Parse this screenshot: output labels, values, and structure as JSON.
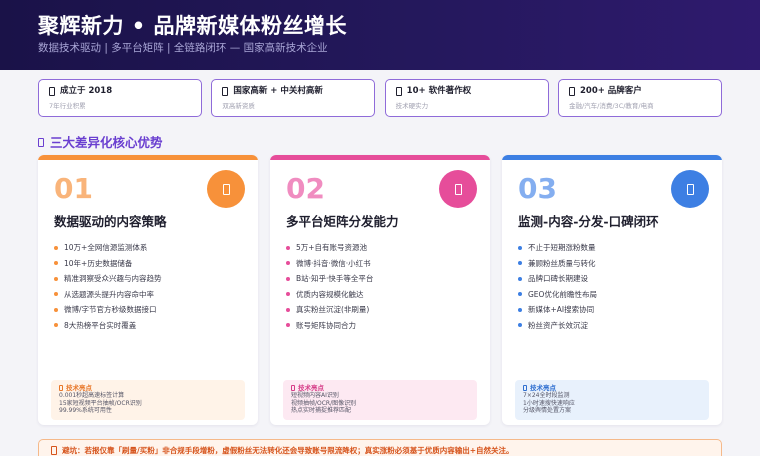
{
  "header": {
    "title": "聚辉新力 • 品牌新媒体粉丝增长",
    "subtitle": "数据技术驱动 | 多平台矩阵 | 全链路闭环 — 国家高新技术企业"
  },
  "badges": [
    {
      "title": "成立于 2018",
      "sub": "7年行业积累",
      "icon": "calendar-icon"
    },
    {
      "title": "国家高新 + 中关村高新",
      "sub": "双高新资质",
      "icon": "certificate-icon"
    },
    {
      "title": "10+ 软件著作权",
      "sub": "技术硬实力",
      "icon": "document-icon"
    },
    {
      "title": "200+ 品牌客户",
      "sub": "金融/汽车/消费/3C/教育/电商",
      "icon": "users-icon"
    }
  ],
  "section_title": "三大差异化核心优势",
  "cards": [
    {
      "num": "01",
      "title": "数据驱动的内容策略",
      "accent": "#f7913a",
      "tech_bg": "#fff3e8",
      "items": [
        "10万+全网信源监测体系",
        "10年+历史数据储备",
        "精准洞察受众兴趣与内容趋势",
        "从选题源头提升内容命中率",
        "微博/字节官方秒级数据接口",
        "8大热榜平台实时覆盖"
      ],
      "tech_title": "技术亮点",
      "tech_lines": [
        "0.001秒超高速标签计算",
        "15家短视频平台抽帧/OCR识别",
        "99.99%系统可用性"
      ]
    },
    {
      "num": "02",
      "title": "多平台矩阵分发能力",
      "accent": "#e64d9a",
      "tech_bg": "#fde9f2",
      "items": [
        "5万+自有账号资源池",
        "微博·抖音·微信·小红书",
        "B站·知乎·快手等全平台",
        "优质内容规模化触达",
        "真实粉丝沉淀(非刷量)",
        "账号矩阵协同合力"
      ],
      "tech_title": "技术亮点",
      "tech_lines": [
        "短视频内容AI识别",
        "视频抽帧/OCR/图像识别",
        "热点实时捕捉推荐匹配"
      ]
    },
    {
      "num": "03",
      "title": "监测-内容-分发-口碑闭环",
      "accent": "#3d7fe3",
      "tech_bg": "#e8f1fc",
      "items": [
        "不止于短期涨粉数量",
        "兼顾粉丝质量与转化",
        "品牌口碑长期建设",
        "GEO优化前瞻性布局",
        "新媒体+AI搜索协同",
        "粉丝资产长效沉淀"
      ],
      "tech_title": "技术亮点",
      "tech_lines": [
        "7×24全时段监测",
        "1小时速搜快速响应",
        "分级舆情处置方案"
      ]
    }
  ],
  "warning": "避坑：若报仅靠「刷量/买粉」非合规手段增粉，虚假粉丝无法转化还会导致账号限流降权；真实涨粉必须基于优质内容输出+自然关注。"
}
